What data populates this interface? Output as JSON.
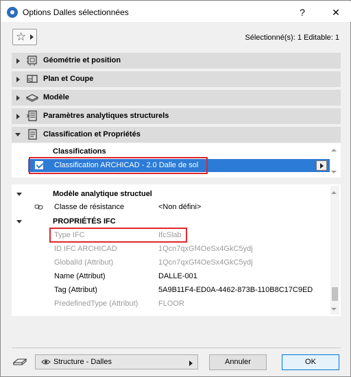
{
  "window": {
    "title": "Options Dalles sélectionnées",
    "help_label": "?",
    "close_label": "✕"
  },
  "header": {
    "favorites_icon": "star-icon",
    "selection_info": "Sélectionné(s): 1 Editable: 1"
  },
  "sections": [
    {
      "label": "Géométrie et position",
      "icon": "geometry-icon",
      "expanded": false
    },
    {
      "label": "Plan et Coupe",
      "icon": "floorplan-icon",
      "expanded": false
    },
    {
      "label": "Modèle",
      "icon": "model-icon",
      "expanded": false
    },
    {
      "label": "Paramètres analytiques structurels",
      "icon": "analytic-icon",
      "expanded": false
    },
    {
      "label": "Classification et Propriétés",
      "icon": "classification-icon",
      "expanded": true
    }
  ],
  "classifications": {
    "header": "Classifications",
    "row_text": "Classification ARCHICAD - 2.0 Dalle de sol",
    "checked": true
  },
  "properties": {
    "group1": {
      "title": "Modèle analytique structuel",
      "rows": [
        {
          "name": "Classe de résistance",
          "value": "<Non défini>"
        }
      ]
    },
    "group2": {
      "title": "PROPRIÉTÉS IFC",
      "rows": [
        {
          "name": "Type IFC",
          "value": "IfcSlab",
          "greyed": true
        },
        {
          "name": "ID IFC ARCHICAD",
          "value": "1Qcn7qxGf4OeSx4GkC5ydj",
          "greyed": true
        },
        {
          "name": "GlobalId (Attribut)",
          "value": "1Qcn7qxGf4OeSx4GkC5ydj",
          "greyed": true
        },
        {
          "name": "Name (Attribut)",
          "value": "DALLE-001",
          "greyed": false
        },
        {
          "name": "Tag (Attribut)",
          "value": "5A9B11F4-ED0A-4462-873B-110B8C17C9ED",
          "greyed": false
        },
        {
          "name": "PredefinedType (Attribut)",
          "value": "FLOOR",
          "greyed": true
        }
      ]
    }
  },
  "footer": {
    "layer_combo": "Structure - Dalles",
    "cancel_label": "Annuler",
    "ok_label": "OK"
  },
  "colors": {
    "selection_blue": "#2c7bd6",
    "highlight_red": "#e0262a",
    "section_bg": "#dcdcdc"
  }
}
